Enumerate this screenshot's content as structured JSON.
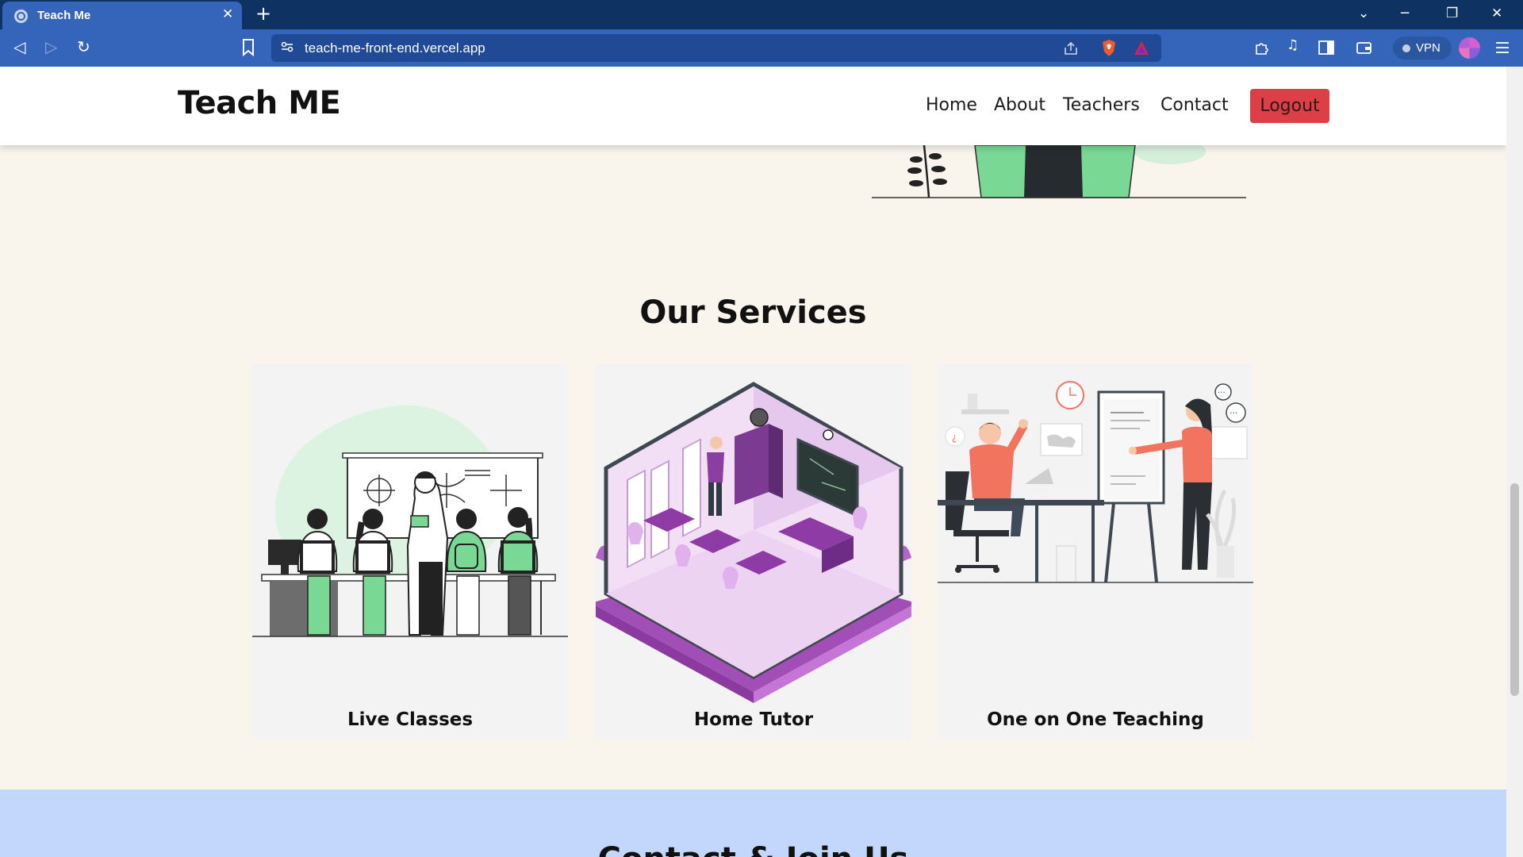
{
  "browser": {
    "tab_title": "Teach Me",
    "tab_close": "✕",
    "new_tab": "+",
    "url": "teach-me-front-end.vercel.app",
    "vpn_label": "VPN",
    "window_controls": {
      "list": "⌄",
      "minimize": "─",
      "restore": "❐",
      "close": "✕"
    },
    "nav": {
      "back": "◁",
      "forward": "▷",
      "reload": "↻"
    }
  },
  "site": {
    "brand": "Teach ME",
    "nav": [
      "Home",
      "About",
      "Teachers",
      "Contact"
    ],
    "logout_label": "Logout"
  },
  "services": {
    "title": "Our Services",
    "cards": [
      {
        "label": "Live Classes",
        "image": "classroom-illustration"
      },
      {
        "label": "Home Tutor",
        "image": "isometric-room-illustration"
      },
      {
        "label": "One on One Teaching",
        "image": "whiteboard-lesson-illustration"
      }
    ]
  },
  "contact": {
    "title": "Contact & Join Us"
  },
  "colors": {
    "chrome_dark": "#0e3363",
    "chrome": "#3565bb",
    "page_bg": "#f9f5ed",
    "card_bg": "#f3f3f3",
    "logout": "#dc3f45",
    "contact_bg": "#c2d7fb",
    "green_accent": "#79d894",
    "purple_accent": "#a14fb6",
    "coral_accent": "#f2735e"
  }
}
